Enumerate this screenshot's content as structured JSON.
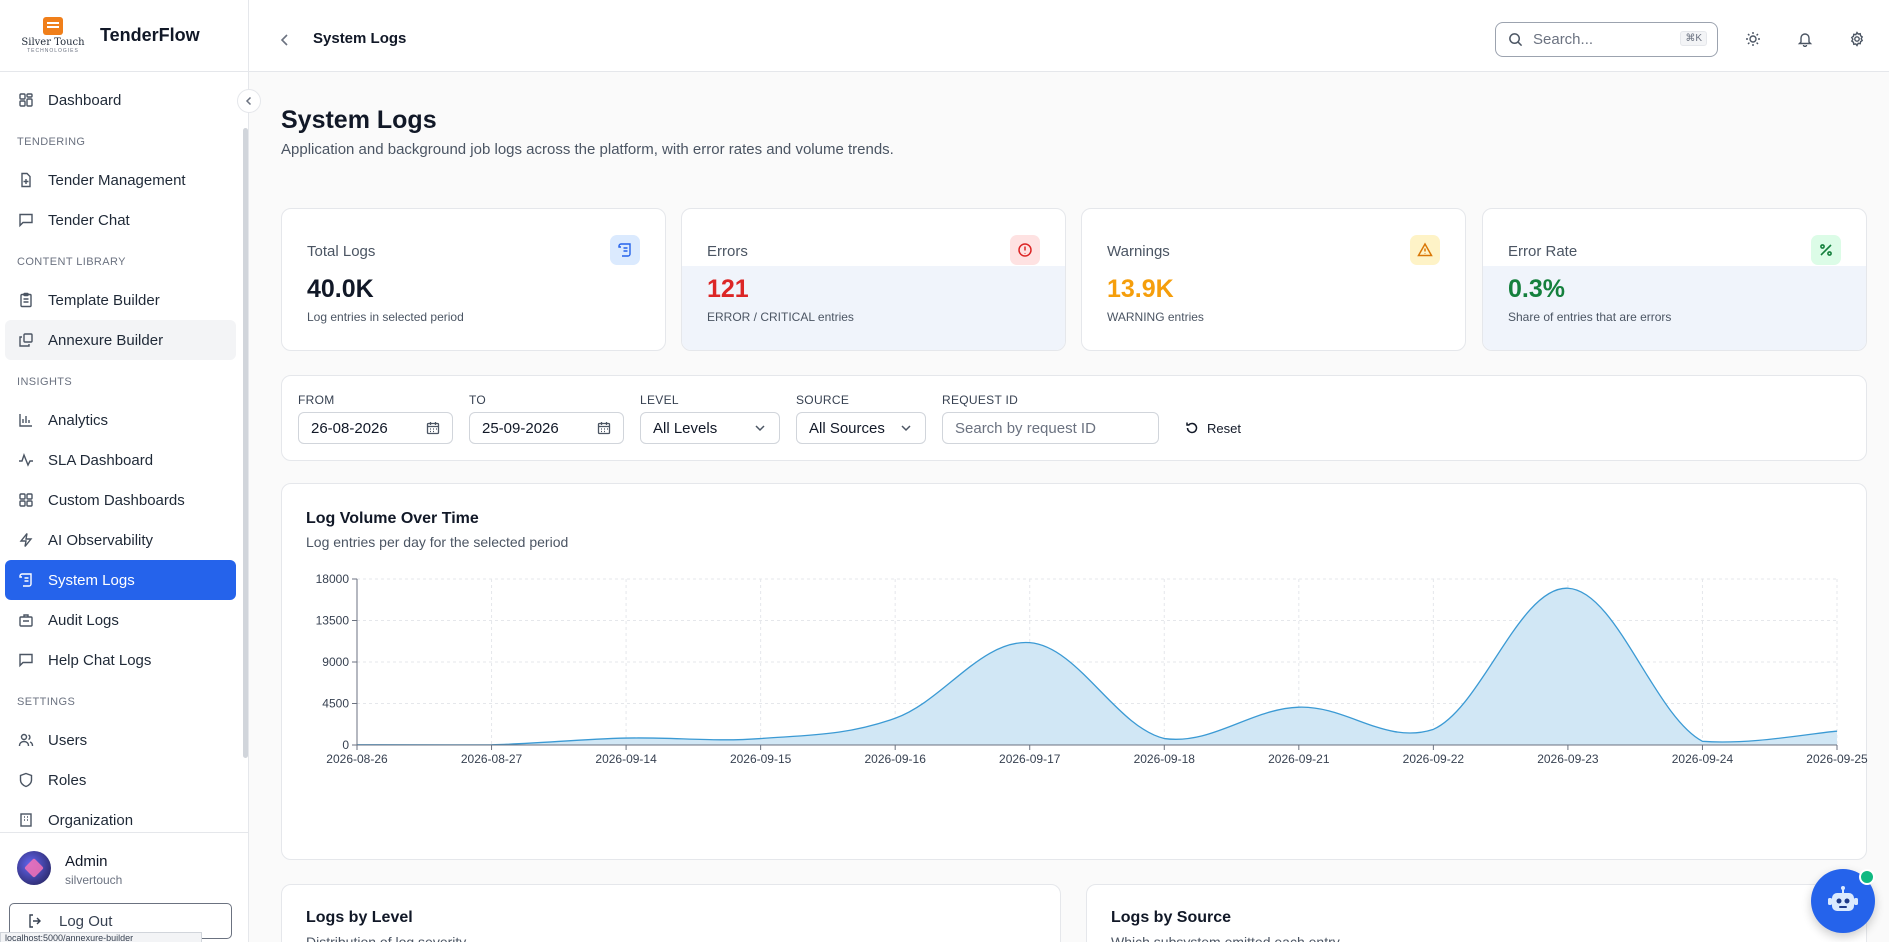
{
  "brand": {
    "logo_text": "Silver Touch",
    "logo_sub": "TECHNOLOGIES",
    "name": "TenderFlow"
  },
  "sidebar": {
    "dashboard": "Dashboard",
    "sections": {
      "tendering": "TENDERING",
      "content_library": "CONTENT LIBRARY",
      "insights": "INSIGHTS",
      "settings": "SETTINGS"
    },
    "items": {
      "tender_management": "Tender Management",
      "tender_chat": "Tender Chat",
      "template_builder": "Template Builder",
      "annexure_builder": "Annexure Builder",
      "analytics": "Analytics",
      "sla_dashboard": "SLA Dashboard",
      "custom_dashboards": "Custom Dashboards",
      "ai_observability": "AI Observability",
      "system_logs": "System Logs",
      "audit_logs": "Audit Logs",
      "help_chat_logs": "Help Chat Logs",
      "users": "Users",
      "roles": "Roles",
      "organization": "Organization"
    },
    "active": "system_logs"
  },
  "user": {
    "name": "Admin",
    "org": "silvertouch",
    "logout": "Log Out"
  },
  "status_url": "localhost:5000/annexure-builder",
  "topbar": {
    "breadcrumb": "System Logs",
    "search_placeholder": "Search...",
    "shortcut": "⌘K"
  },
  "page": {
    "title": "System Logs",
    "subtitle": "Application and background job logs across the platform, with error rates and volume trends."
  },
  "stats": [
    {
      "label": "Total Logs",
      "value": "40.0K",
      "desc": "Log entries in selected period",
      "color": "#111827",
      "icon": "scroll-icon"
    },
    {
      "label": "Errors",
      "value": "121",
      "desc": "ERROR / CRITICAL entries",
      "color": "#dc2626",
      "icon": "alert-circle-icon"
    },
    {
      "label": "Warnings",
      "value": "13.9K",
      "desc": "WARNING entries",
      "color": "#f59e0b",
      "icon": "alert-triangle-icon"
    },
    {
      "label": "Error Rate",
      "value": "0.3%",
      "desc": "Share of entries that are errors",
      "color": "#15803d",
      "icon": "percent-icon"
    }
  ],
  "filters": {
    "from_label": "FROM",
    "from_value": "26-08-2026",
    "to_label": "TO",
    "to_value": "25-09-2026",
    "level_label": "LEVEL",
    "level_value": "All Levels",
    "source_label": "SOURCE",
    "source_value": "All Sources",
    "request_label": "REQUEST ID",
    "request_placeholder": "Search by request ID",
    "reset": "Reset"
  },
  "chart_data": {
    "type": "area",
    "title": "Log Volume Over Time",
    "subtitle": "Log entries per day for the selected period",
    "x": [
      "2026-08-26",
      "2026-08-27",
      "2026-09-14",
      "2026-09-15",
      "2026-09-16",
      "2026-09-17",
      "2026-09-18",
      "2026-09-21",
      "2026-09-22",
      "2026-09-23",
      "2026-09-24",
      "2026-09-25"
    ],
    "y": [
      30,
      20,
      750,
      700,
      2900,
      11100,
      700,
      4100,
      1700,
      17000,
      400,
      1500
    ],
    "ylim": [
      0,
      18000
    ],
    "yticks": [
      0,
      4500,
      9000,
      13500,
      18000
    ],
    "grid": true,
    "color": "#3b9ad4",
    "fill": "#d1e7f5"
  },
  "lower_cards": [
    {
      "title": "Logs by Level",
      "subtitle": "Distribution of log severity"
    },
    {
      "title": "Logs by Source",
      "subtitle": "Which subsystem emitted each entry"
    }
  ]
}
